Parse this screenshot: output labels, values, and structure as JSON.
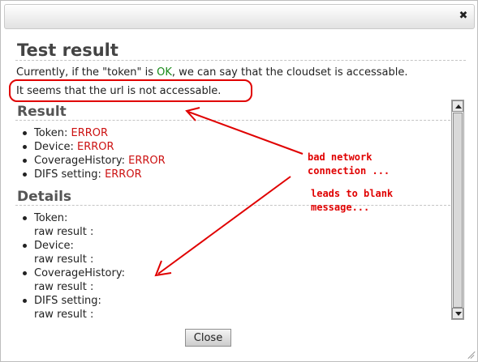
{
  "window": {
    "close_icon": "close-icon"
  },
  "title": "Test result",
  "intro": {
    "before": "Currently, if the \"token\" is ",
    "ok": "OK",
    "after": ", we can say that the cloudset is accessable."
  },
  "message": "It seems that the url is not accessable.",
  "result": {
    "heading": "Result",
    "items": [
      {
        "label": "Token: ",
        "status": "ERROR"
      },
      {
        "label": "Device: ",
        "status": "ERROR"
      },
      {
        "label": "CoverageHistory: ",
        "status": "ERROR"
      },
      {
        "label": "DIFS setting: ",
        "status": "ERROR"
      }
    ]
  },
  "details": {
    "heading": "Details",
    "items": [
      {
        "label": "Token:",
        "raw": "raw result :"
      },
      {
        "label": "Device:",
        "raw": "raw result :"
      },
      {
        "label": "CoverageHistory:",
        "raw": "raw result :"
      },
      {
        "label": "DIFS setting:",
        "raw": "raw result :"
      }
    ]
  },
  "buttons": {
    "close": "Close"
  },
  "annotation": {
    "note1": "bad network\nconnection ...",
    "note2": "leads to blank\nmessage...",
    "color": "#e00000"
  },
  "colors": {
    "ok": "#1a8a1a",
    "error": "#cc1111"
  }
}
